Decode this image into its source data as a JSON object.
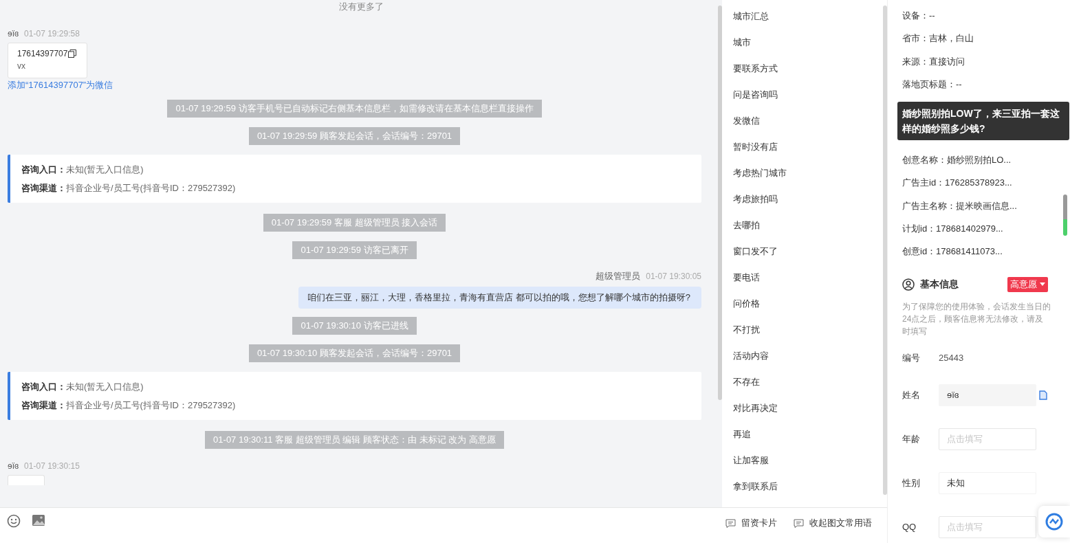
{
  "chat": {
    "no_more": "没有更多了",
    "messages": [
      {
        "kind": "visitor_card",
        "sender": "ɘïɞ",
        "time": "01-07 19:29:58",
        "number": "17614397707",
        "note": "vx",
        "link": "添加“17614397707”为微信"
      },
      {
        "kind": "system",
        "text": "01-07 19:29:59 访客手机号已自动标记右侧基本信息栏，如需修改请在基本信息栏直接操作"
      },
      {
        "kind": "system",
        "text": "01-07 19:29:59 顾客发起会话，会话编号：29701"
      },
      {
        "kind": "info",
        "rows": [
          {
            "label": "咨询入口：",
            "value": "未知(暂无入口信息)"
          },
          {
            "label": "咨询渠道：",
            "value": "抖音企业号/员工号(抖音号ID：279527392)"
          }
        ]
      },
      {
        "kind": "system",
        "text": "01-07 19:29:59 客服 超级管理员 接入会话"
      },
      {
        "kind": "system",
        "text": "01-07 19:29:59 访客已离开"
      },
      {
        "kind": "agent",
        "sender": "超级管理员",
        "time": "01-07 19:30:05",
        "text": "咱们在三亚，丽江，大理，香格里拉，青海有直营店 都可以拍的哦，您想了解哪个城市的拍摄呀?"
      },
      {
        "kind": "system",
        "text": "01-07 19:30:10 访客已进线"
      },
      {
        "kind": "system",
        "text": "01-07 19:30:10 顾客发起会话，会话编号：29701"
      },
      {
        "kind": "info",
        "rows": [
          {
            "label": "咨询入口：",
            "value": "未知(暂无入口信息)"
          },
          {
            "label": "咨询渠道：",
            "value": "抖音企业号/员工号(抖音号ID：279527392)"
          }
        ]
      },
      {
        "kind": "system",
        "text": "01-07 19:30:11 客服 超级管理员 编辑 顾客状态：由 未标记 改为 高意愿"
      },
      {
        "kind": "visitor_stub",
        "sender": "ɘïɞ",
        "time": "01-07 19:30:15"
      }
    ]
  },
  "toolbar": {
    "buttons": [
      "留资卡片",
      "收起图文常用语"
    ]
  },
  "quick_phrases": [
    "城市汇总",
    "城市",
    "要联系方式",
    "问是咨询吗",
    "发微信",
    "暂时没有店",
    "考虑热门城市",
    "考虑旅拍吗",
    "去哪拍",
    "窗口发不了",
    "要电话",
    "问价格",
    "不打扰",
    "活动内容",
    "不存在",
    "对比再决定",
    "再追",
    "让加客服",
    "拿到联系后"
  ],
  "visitor_info": {
    "rows": [
      "设备：--",
      "省市：吉林，白山",
      "来源：直接访问",
      "落地页标题：--",
      "创意名称：婚纱照别拍LO...",
      "广告主id：176285378923...",
      "广告主名称：提米映画信息...",
      "计划id：178681402979...",
      "创意id：178681411073..."
    ],
    "tooltip": "婚纱照别拍LOW了，来三亚拍一套这样的婚纱照多少钱?"
  },
  "basic_info": {
    "title": "基本信息",
    "intent_tag": "高意愿",
    "notice": "为了保障您的使用体验，会话发生当日的24点之后，顾客信息将无法修改，请及时填写",
    "fields": [
      {
        "kind": "text",
        "label": "编号",
        "value": "25443"
      },
      {
        "kind": "readonly",
        "label": "姓名",
        "value": "ɘïɞ"
      },
      {
        "kind": "input",
        "label": "年龄",
        "placeholder": "点击填写"
      },
      {
        "kind": "select",
        "label": "性别",
        "value": "未知"
      },
      {
        "kind": "input",
        "label": "QQ",
        "placeholder": "点击填写"
      }
    ]
  }
}
